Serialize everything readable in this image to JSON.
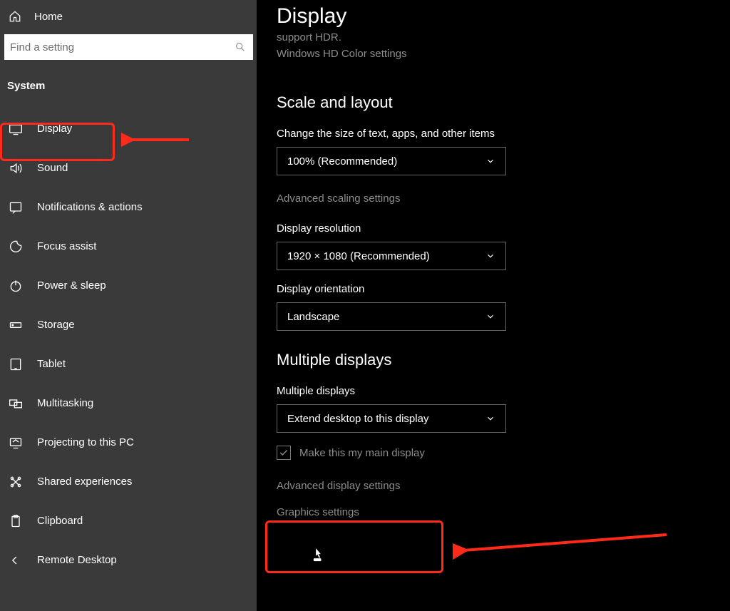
{
  "sidebar": {
    "home": "Home",
    "search_placeholder": "Find a setting",
    "section": "System",
    "items": [
      {
        "icon": "display-icon",
        "label": "Display"
      },
      {
        "icon": "sound-icon",
        "label": "Sound"
      },
      {
        "icon": "notifications-icon",
        "label": "Notifications & actions"
      },
      {
        "icon": "focus-icon",
        "label": "Focus assist"
      },
      {
        "icon": "power-icon",
        "label": "Power & sleep"
      },
      {
        "icon": "storage-icon",
        "label": "Storage"
      },
      {
        "icon": "tablet-icon",
        "label": "Tablet"
      },
      {
        "icon": "multitask-icon",
        "label": "Multitasking"
      },
      {
        "icon": "projecting-icon",
        "label": "Projecting to this PC"
      },
      {
        "icon": "shared-icon",
        "label": "Shared experiences"
      },
      {
        "icon": "clipboard-icon",
        "label": "Clipboard"
      },
      {
        "icon": "remote-icon",
        "label": "Remote Desktop"
      }
    ]
  },
  "page": {
    "title": "Display",
    "truncated": "support HDR.",
    "hdcolor_link": "Windows HD Color settings",
    "scale": {
      "heading": "Scale and layout",
      "size_label": "Change the size of text, apps, and other items",
      "size_value": "100% (Recommended)",
      "adv_scaling": "Advanced scaling settings",
      "resolution_label": "Display resolution",
      "resolution_value": "1920 × 1080 (Recommended)",
      "orientation_label": "Display orientation",
      "orientation_value": "Landscape"
    },
    "multi": {
      "heading": "Multiple displays",
      "label": "Multiple displays",
      "value": "Extend desktop to this display",
      "main_display": "Make this my main display",
      "adv_display": "Advanced display settings",
      "graphics": "Graphics settings"
    }
  }
}
